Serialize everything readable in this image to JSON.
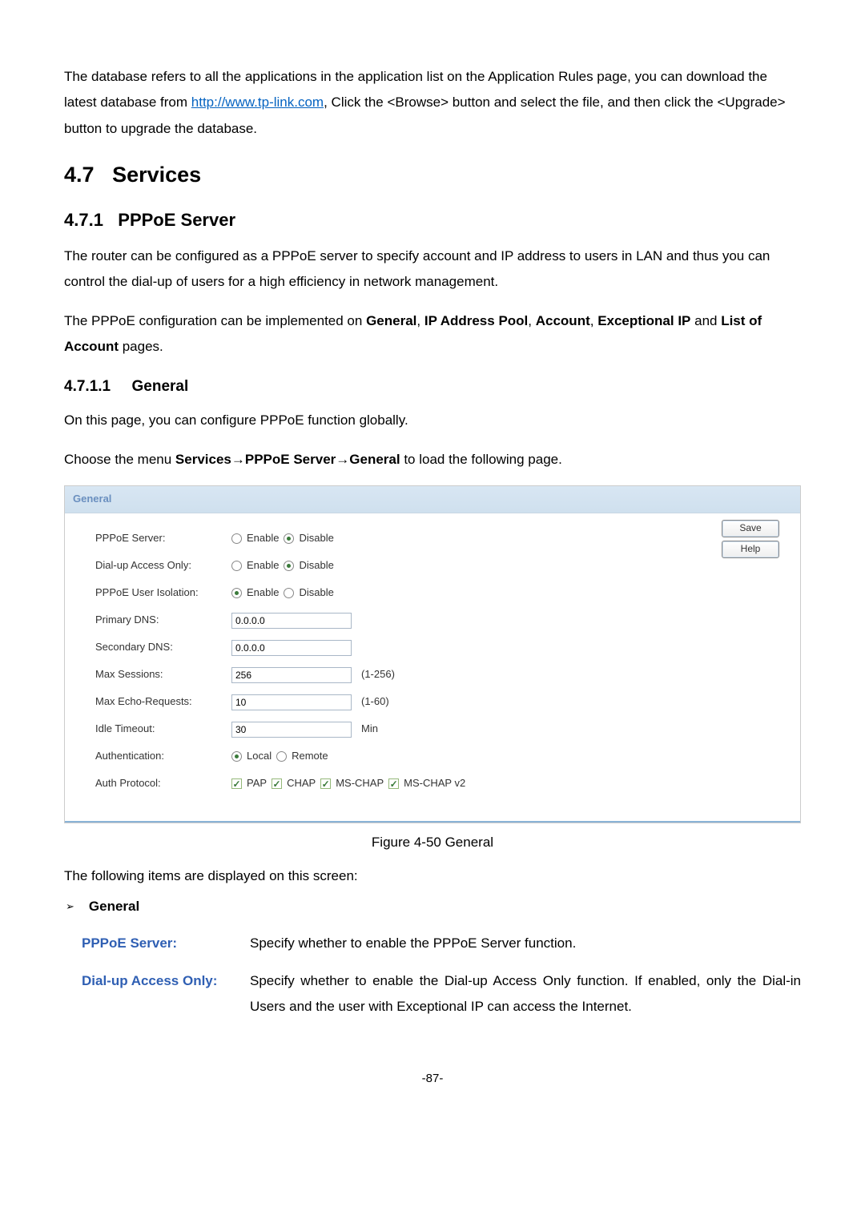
{
  "intro": {
    "para1_pre": "The database refers to all the applications in the application list on the Application Rules page, you can download the latest database from ",
    "link_text": "http://www.tp-link.com",
    "para1_post": ", Click the <Browse> button and select the file, and then click the <Upgrade> button to upgrade the database."
  },
  "sec47": {
    "num": "4.7",
    "title": "Services"
  },
  "sec471": {
    "num": "4.7.1",
    "title": "PPPoE Server",
    "para1": "The router can be configured as a PPPoE server to specify account and IP address to users in LAN and thus you can control the dial-up of users for a high efficiency in network management.",
    "para2_pre": "The PPPoE configuration can be implemented on ",
    "b1": "General",
    "b2": "IP Address Pool",
    "b3": "Account",
    "b4": "Exceptional IP",
    "b5": "List of Account",
    "para2_mid_and": " and ",
    "para2_end": " pages."
  },
  "sec4711": {
    "num": "4.7.1.1",
    "title": "General",
    "para1": "On this page, you can configure PPPoE function globally.",
    "para2_pre": "Choose the menu ",
    "m1": "Services",
    "m2": "PPPoE Server",
    "m3": "General",
    "para2_post": " to load the following page."
  },
  "panel": {
    "header": "General",
    "labels": {
      "pppoe_server": "PPPoE Server:",
      "dialup": "Dial-up Access Only:",
      "isolation": "PPPoE User Isolation:",
      "pdns": "Primary DNS:",
      "sdns": "Secondary DNS:",
      "maxsess": "Max Sessions:",
      "maxecho": "Max Echo-Requests:",
      "idle": "Idle Timeout:",
      "auth": "Authentication:",
      "authproto": "Auth Protocol:"
    },
    "opts": {
      "enable": "Enable",
      "disable": "Disable",
      "local": "Local",
      "remote": "Remote",
      "pap": "PAP",
      "chap": "CHAP",
      "mschap": "MS-CHAP",
      "mschapv2": "MS-CHAP v2"
    },
    "values": {
      "pdns": "0.0.0.0",
      "sdns": "0.0.0.0",
      "maxsess": "256",
      "maxecho": "10",
      "idle": "30"
    },
    "aux": {
      "maxsess": "(1-256)",
      "maxecho": "(1-60)",
      "idle": "Min"
    },
    "buttons": {
      "save": "Save",
      "help": "Help"
    }
  },
  "caption": "Figure 4-50 General",
  "followup": "The following items are displayed on this screen:",
  "bullet_general": "General",
  "defs": {
    "pppoe_server": {
      "term": "PPPoE Server:",
      "desc": "Specify whether to enable the PPPoE Server function."
    },
    "dialup": {
      "term": "Dial-up Access Only:",
      "desc": "Specify whether to enable the Dial-up Access Only function. If enabled, only the Dial-in Users and the user with Exceptional IP can access the Internet."
    }
  },
  "page_num": "-87-"
}
